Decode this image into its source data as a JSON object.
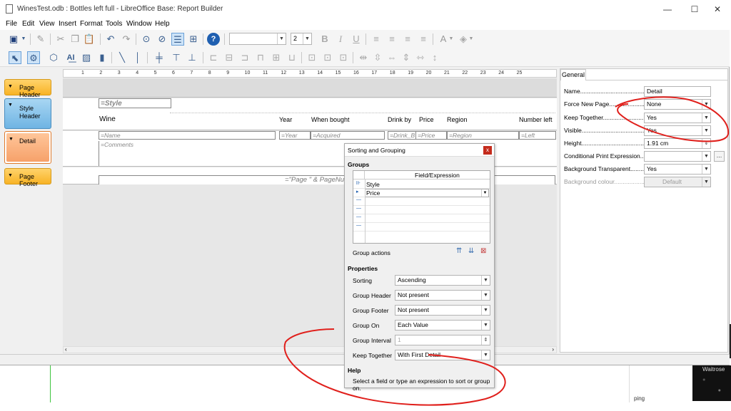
{
  "window": {
    "title": "WinesTest.odb : Bottles left full - LibreOffice Base: Report Builder",
    "minimize": "—",
    "maximize": "☐",
    "close": "✕"
  },
  "menu": [
    "File",
    "Edit",
    "View",
    "Insert",
    "Format",
    "Tools",
    "Window",
    "Help"
  ],
  "toolbar": {
    "font_name": "",
    "font_size": "2",
    "bold": "B",
    "italic": "I",
    "underline": "U"
  },
  "sections": {
    "page_header": "Page Header",
    "style_header": "Style Header",
    "detail": "Detail",
    "page_footer": "Page Footer"
  },
  "ruler_ticks": [
    "1",
    "2",
    "3",
    "4",
    "5",
    "6",
    "7",
    "8",
    "9",
    "10",
    "11",
    "12",
    "13",
    "14",
    "15",
    "16",
    "17",
    "18",
    "19",
    "20",
    "21",
    "22",
    "23",
    "24",
    "25"
  ],
  "report": {
    "style_field": "=Style",
    "header_labels": {
      "wine": "Wine",
      "year": "Year",
      "when_bought": "When bought",
      "drink_by": "Drink by",
      "price": "Price",
      "region": "Region",
      "number_left": "Number left"
    },
    "detail_fields": {
      "name": "=Name",
      "year": "=Year",
      "acquired": "=Acquired",
      "drink_by": "=Drink_B",
      "price": "=Price",
      "region": "=Region",
      "left": "=Left",
      "comments": "=Comments"
    },
    "footer_field": "=\"Page \" & PageNumber() &"
  },
  "properties": {
    "tab": "General",
    "rows": [
      {
        "label": "Name..............................................",
        "value": "Detail"
      },
      {
        "label": "Force New Page...............................",
        "value": "None"
      },
      {
        "label": "Keep Together.................................",
        "value": "Yes"
      },
      {
        "label": "Visible.............................................",
        "value": "Yes"
      },
      {
        "label": "Height..............................................",
        "value": "1.91 cm"
      },
      {
        "label": "Conditional Print Expression.........",
        "value": ""
      },
      {
        "label": "Background Transparent..........",
        "value": "Yes"
      },
      {
        "label": "Background colour..................",
        "value": "Default"
      }
    ]
  },
  "dialog": {
    "title": "Sorting and Grouping",
    "close": "x",
    "groups_heading": "Groups",
    "grid_header": "Field/Expression",
    "grid_rows": [
      "Style",
      "Price",
      "",
      "",
      "",
      ""
    ],
    "group_actions": "Group actions",
    "properties_heading": "Properties",
    "fields": [
      {
        "label": "Sorting",
        "value": "Ascending"
      },
      {
        "label": "Group Header",
        "value": "Not present"
      },
      {
        "label": "Group Footer",
        "value": "Not present"
      },
      {
        "label": "Group On",
        "value": "Each Value"
      },
      {
        "label": "Group Interval",
        "value": "1"
      },
      {
        "label": "Keep Together",
        "value": "With First Detail"
      }
    ],
    "help_heading": "Help",
    "help_text": "Select a field or type an expression to sort or group on."
  },
  "background": {
    "waitrose_text": "Waitrose",
    "partial_text": "ping"
  },
  "colors": {
    "annotation": "#e0201c",
    "section_orange": "#f8b326",
    "section_blue": "#6fb4e3",
    "detail_orange": "#f6a16a",
    "close_red": "#c42b1c"
  }
}
